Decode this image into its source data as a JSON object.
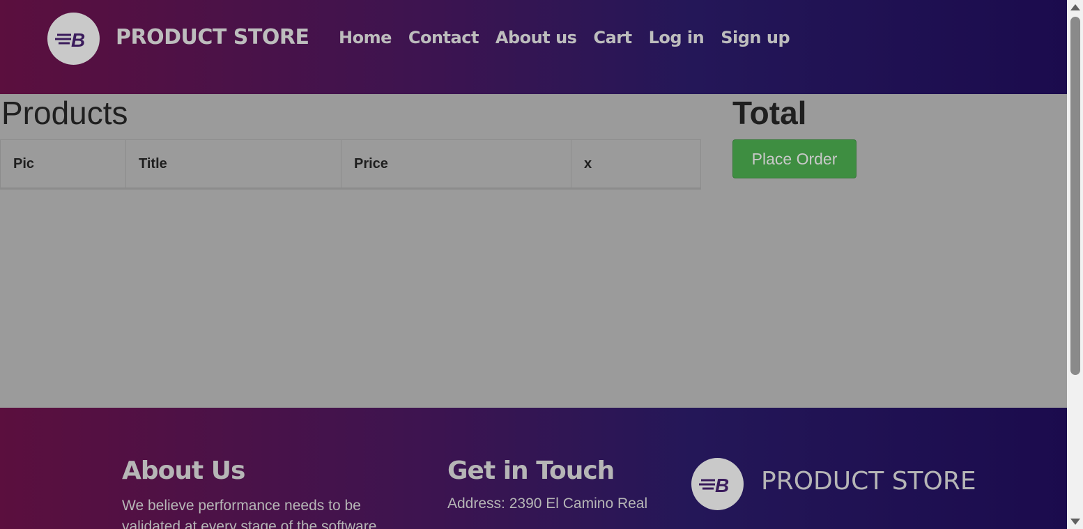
{
  "navbar": {
    "brand": "PRODUCT STORE",
    "links": [
      "Home",
      "Contact",
      "About us",
      "Cart",
      "Log in",
      "Sign up"
    ]
  },
  "main": {
    "products_title": "Products",
    "total_title": "Total",
    "table_headers": [
      "Pic",
      "Title",
      "Price",
      "x"
    ],
    "place_order_label": "Place Order"
  },
  "footer": {
    "about_title": "About Us",
    "about_text": "We believe performance needs to be validated at every stage of the software",
    "contact_title": "Get in Touch",
    "contact_address": "Address: 2390 El Camino Real",
    "brand": "PRODUCT STORE"
  },
  "colors": {
    "header_gradient_start": "#5b0f3e",
    "header_gradient_end": "#1b0b4d",
    "main_bg": "#9b9b9b",
    "place_order_bg": "#3e8e41"
  },
  "icons": {
    "brand_logo": "bm-logo-icon"
  }
}
